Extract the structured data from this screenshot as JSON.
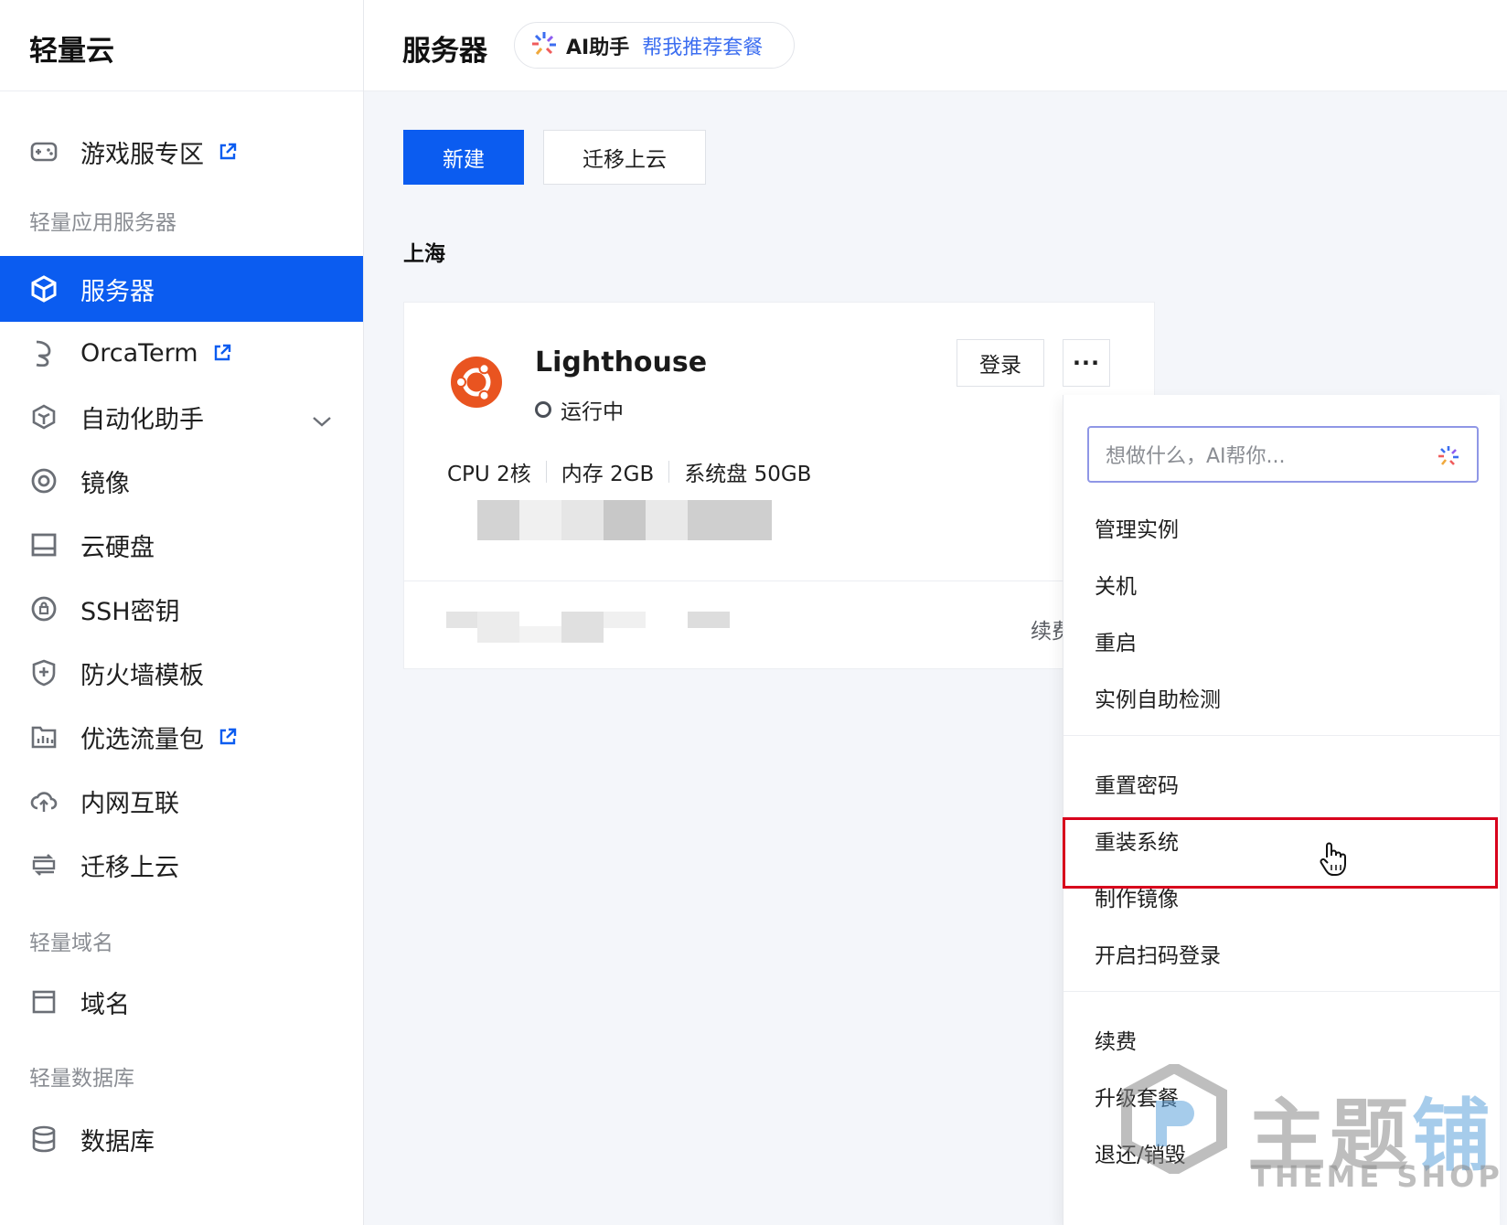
{
  "sidebar": {
    "brand": "轻量云",
    "game_zone": "游戏服专区",
    "section_lighthouse": "轻量应用服务器",
    "items": [
      {
        "label": "服务器",
        "icon": "cube-icon"
      },
      {
        "label": "OrcaTerm",
        "icon": "terminal-icon"
      },
      {
        "label": "自动化助手",
        "icon": "automation-icon"
      },
      {
        "label": "镜像",
        "icon": "image-icon"
      },
      {
        "label": "云硬盘",
        "icon": "disk-icon"
      },
      {
        "label": "SSH密钥",
        "icon": "key-icon"
      },
      {
        "label": "防火墙模板",
        "icon": "shield-icon"
      },
      {
        "label": "优选流量包",
        "icon": "traffic-icon"
      },
      {
        "label": "内网互联",
        "icon": "cloud-link-icon"
      },
      {
        "label": "迁移上云",
        "icon": "migrate-icon"
      }
    ],
    "section_domain": "轻量域名",
    "domain_item": "域名",
    "section_db": "轻量数据库",
    "db_item": "数据库"
  },
  "header": {
    "title": "服务器",
    "ai_label": "AI助手",
    "ai_link": "帮我推荐套餐"
  },
  "toolbar": {
    "new_label": "新建",
    "migrate_label": "迁移上云"
  },
  "region": "上海",
  "instance": {
    "name": "Lighthouse",
    "status": "运行中",
    "cpu": "CPU 2核",
    "memory": "内存 2GB",
    "disk": "系统盘 50GB",
    "login_label": "登录",
    "more_label": "···",
    "renew_label": "续费"
  },
  "menu": {
    "ai_placeholder": "想做什么，AI帮你...",
    "group1": [
      "管理实例",
      "关机",
      "重启",
      "实例自助检测"
    ],
    "group2": [
      "重置密码",
      "重装系统",
      "制作镜像",
      "开启扫码登录"
    ],
    "group3": [
      "续费",
      "升级套餐",
      "退还/销毁"
    ]
  },
  "watermark": {
    "cn_gray": "主题",
    "cn_blue": "铺",
    "en": "THEME SHOP"
  },
  "colors": {
    "primary": "#0b5cf0",
    "highlight": "#d8001c",
    "link": "#3c6ef0",
    "ubuntu": "#e95420"
  }
}
